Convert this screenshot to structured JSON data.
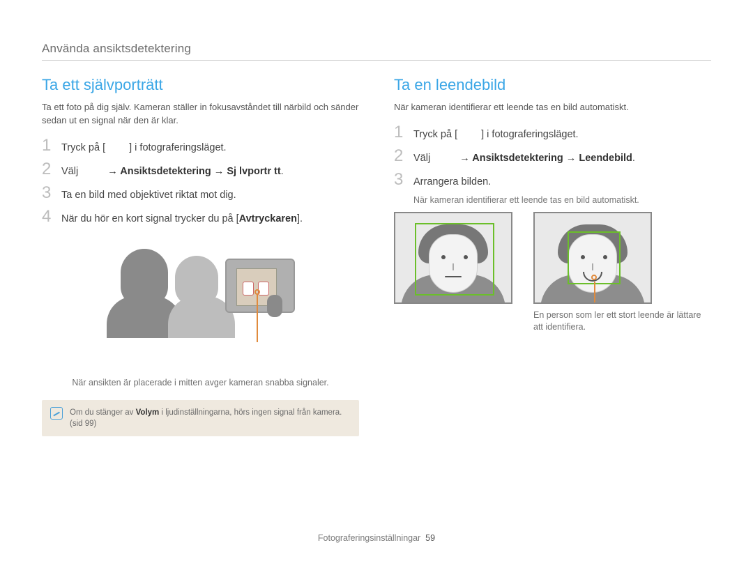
{
  "chapter": "Använda ansiktsdetektering",
  "left": {
    "heading": "Ta ett självporträtt",
    "intro": "Ta ett foto på dig själv. Kameran ställer in fokusavståndet till närbild och sänder sedan ut en signal när den är klar.",
    "steps": {
      "s1_a": "Tryck på [",
      "s1_b": "] i fotograferingsläget.",
      "s2_a": "Välj ",
      "s2_b": " → Ansiktsdetektering → Sj lvportr tt",
      "s2_c": ".",
      "s3": "Ta en bild med objektivet riktat mot dig.",
      "s4_a": "När du hör en kort signal trycker du på [",
      "s4_b": "Avtryckaren",
      "s4_c": "]."
    },
    "caption": "När ansikten är placerade i mitten avger kameran snabba signaler.",
    "note_a": "Om du stänger av ",
    "note_b": "Volym",
    "note_c": " i ljudinställningarna, hörs ingen signal från kamera. (sid 99)"
  },
  "right": {
    "heading": "Ta en leendebild",
    "intro": "När kameran identifierar ett leende tas en bild automatiskt.",
    "steps": {
      "s1_a": "Tryck på [",
      "s1_b": "] i fotograferingsläget.",
      "s2_a": "Välj ",
      "s2_b": " → Ansiktsdetektering → Leendebild",
      "s2_c": ".",
      "s3": "Arrangera bilden.",
      "s3_note": "När kameran identifierar ett leende tas en bild automatiskt."
    },
    "caption": "En person som ler ett stort leende är lättare att identifiera."
  },
  "footer": {
    "section": "Fotograferingsinställningar",
    "page": "59"
  }
}
